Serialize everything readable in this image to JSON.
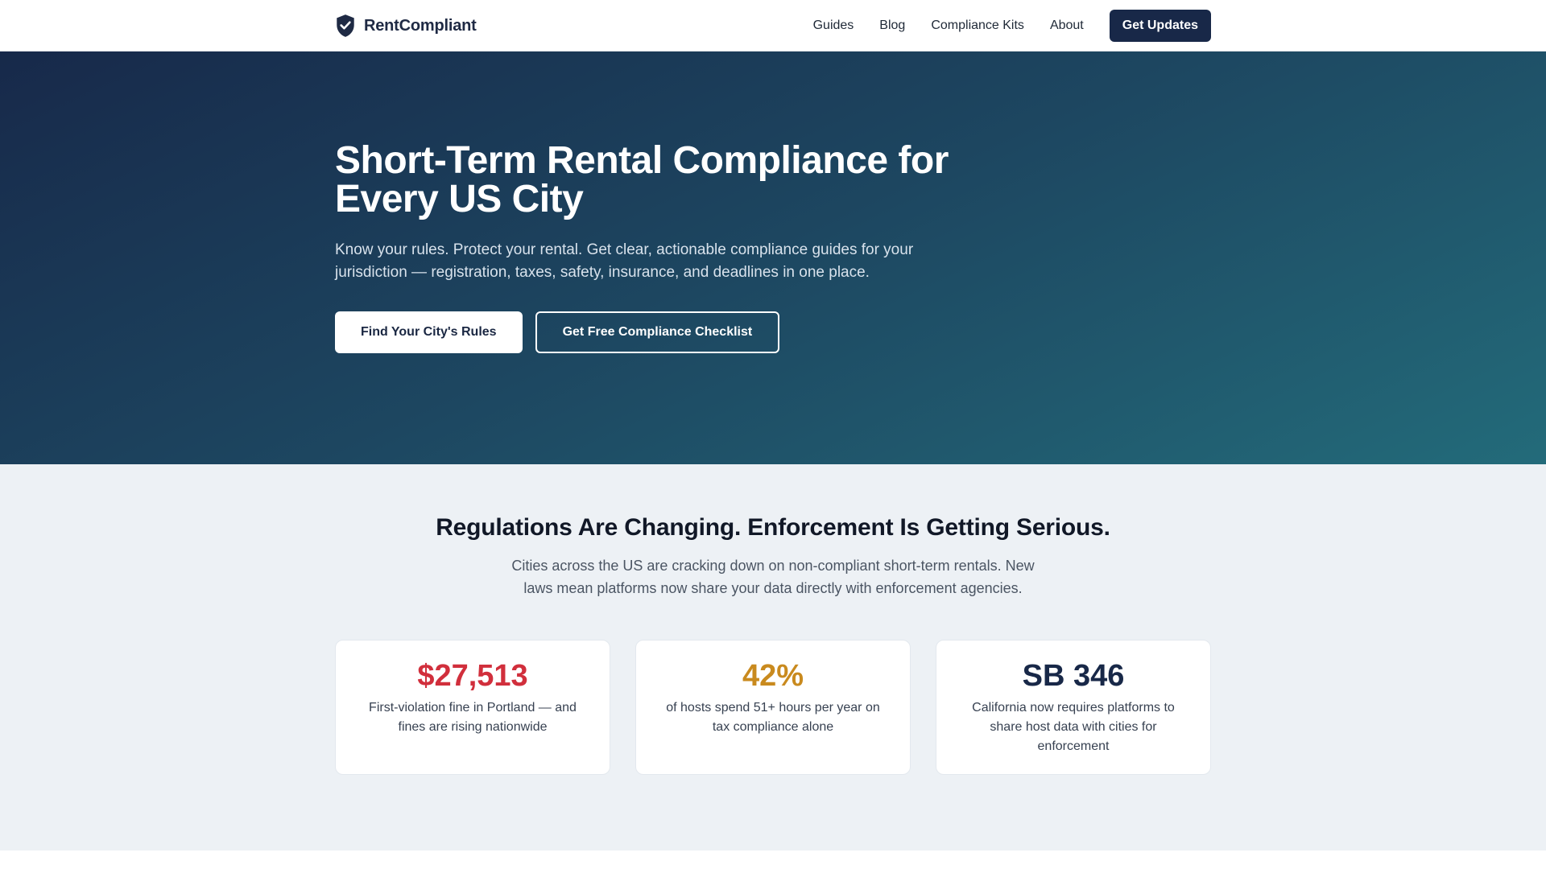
{
  "nav": {
    "brand": "RentCompliant",
    "links": [
      "Guides",
      "Blog",
      "Compliance Kits",
      "About"
    ],
    "cta": "Get Updates"
  },
  "hero": {
    "title": "Short-Term Rental Compliance for Every US City",
    "subtitle": "Know your rules. Protect your rental. Get clear, actionable compliance guides for your jurisdiction — registration, taxes, safety, insurance, and deadlines in one place.",
    "primary_cta": "Find Your City's Rules",
    "secondary_cta": "Get Free Compliance Checklist"
  },
  "stats": {
    "title": "Regulations Are Changing. Enforcement Is Getting Serious.",
    "subtitle": "Cities across the US are cracking down on non-compliant short-term rentals. New laws mean platforms now share your data directly with enforcement agencies.",
    "cards": [
      {
        "value": "$27,513",
        "desc": "First-violation fine in Portland — and fines are rising nationwide",
        "color": "#d12f3c"
      },
      {
        "value": "42%",
        "desc": "of hosts spend 51+ hours per year on tax compliance alone",
        "color": "#c98a1e"
      },
      {
        "value": "SB 346",
        "desc": "California now requires platforms to share host data with cities for enforcement",
        "color": "#182848"
      }
    ]
  },
  "icons": {
    "brand": "shield-check-icon"
  }
}
